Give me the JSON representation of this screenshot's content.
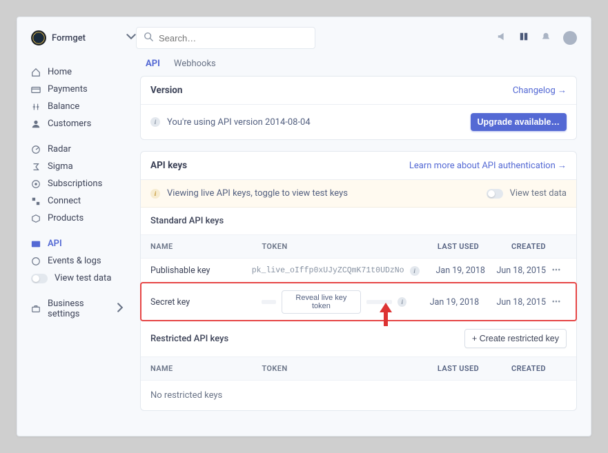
{
  "brand": {
    "name": "Formget"
  },
  "search": {
    "placeholder": "Search…"
  },
  "sidebar": {
    "primary": [
      {
        "label": "Home",
        "icon": "home-icon"
      },
      {
        "label": "Payments",
        "icon": "payments-icon"
      },
      {
        "label": "Balance",
        "icon": "balance-icon"
      },
      {
        "label": "Customers",
        "icon": "customers-icon"
      }
    ],
    "secondary": [
      {
        "label": "Radar",
        "icon": "radar-icon"
      },
      {
        "label": "Sigma",
        "icon": "sigma-icon"
      },
      {
        "label": "Subscriptions",
        "icon": "subscriptions-icon"
      },
      {
        "label": "Connect",
        "icon": "connect-icon"
      },
      {
        "label": "Products",
        "icon": "products-icon"
      }
    ],
    "dev": [
      {
        "label": "API",
        "icon": "api-icon",
        "active": true
      },
      {
        "label": "Events & logs",
        "icon": "events-icon"
      },
      {
        "label": "View test data",
        "icon": "toggle-icon"
      }
    ],
    "settings": {
      "label": "Business settings"
    }
  },
  "tabs": [
    {
      "label": "API",
      "active": true
    },
    {
      "label": "Webhooks",
      "active": false
    }
  ],
  "version_card": {
    "title": "Version",
    "changelog": "Changelog ",
    "info_text": "You're using API version 2014-08-04",
    "upgrade_button": "Upgrade available…"
  },
  "api_keys_card": {
    "title": "API keys",
    "learn_more": "Learn more about API authentication ",
    "notice_text": "Viewing live API keys, toggle to view test keys",
    "view_test_label": "View test data",
    "standard_title": "Standard API keys",
    "columns": {
      "name": "NAME",
      "token": "TOKEN",
      "last_used": "LAST USED",
      "created": "CREATED"
    },
    "rows": [
      {
        "name": "Publishable key",
        "token": "pk_live_oIffp0xUJyZCQmK71t0UDzNo",
        "last_used": "Jan 19, 2018",
        "created": "Jun 18, 2015"
      },
      {
        "name": "Secret key",
        "reveal_label": "Reveal live key token",
        "last_used": "Jan 19, 2018",
        "created": "Jun 18, 2015"
      }
    ],
    "restricted_title": "Restricted API keys",
    "create_restricted": "+ Create restricted key",
    "restricted_empty": "No restricted keys"
  }
}
